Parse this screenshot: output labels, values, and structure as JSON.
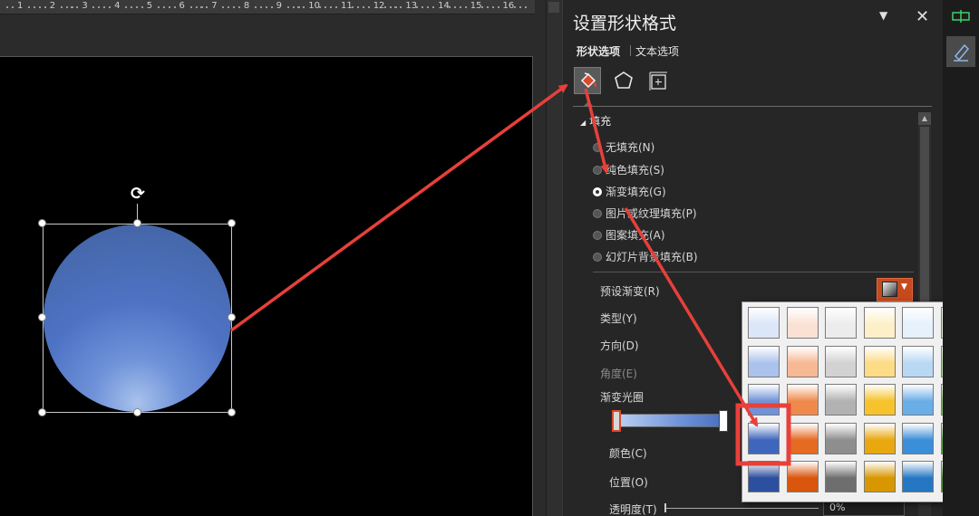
{
  "ruler": {
    "labels": [
      "1",
      "2",
      "3",
      "4",
      "5",
      "6",
      "7",
      "8",
      "9",
      "10",
      "11",
      "12",
      "13",
      "14",
      "15",
      "16"
    ]
  },
  "pane": {
    "title": "设置形状格式",
    "tabs": [
      "形状选项",
      "文本选项"
    ],
    "menu_icon": "chevron-down-icon",
    "close_icon": "close-icon",
    "category_icons": [
      "paint-bucket-icon",
      "pentagon-icon",
      "size-properties-icon"
    ]
  },
  "fill": {
    "section_label": "填充",
    "options": [
      {
        "label": "无填充(N)",
        "checked": false
      },
      {
        "label": "纯色填充(S)",
        "checked": false
      },
      {
        "label": "渐变填充(G)",
        "checked": true
      },
      {
        "label": "图片或纹理填充(P)",
        "checked": false
      },
      {
        "label": "图案填充(A)",
        "checked": false
      },
      {
        "label": "幻灯片背景填充(B)",
        "checked": false
      }
    ]
  },
  "gradient": {
    "preset_label": "预设渐变(R)",
    "type_label": "类型(Y)",
    "direction_label": "方向(D)",
    "angle_label": "角度(E)",
    "stops_label": "渐变光圈",
    "color_label": "颜色(C)",
    "position_label": "位置(O)",
    "transparency_label": "透明度(T)",
    "transparency_value": "0%"
  },
  "preset_gallery": {
    "rows": 5,
    "columns": [
      "blue",
      "orange",
      "gray",
      "gold",
      "lightblue",
      "green"
    ],
    "selected": {
      "row": 4,
      "column": 1
    },
    "colors": {
      "blue": [
        "#dbe6f8",
        "#aac2ec",
        "#6f93d9",
        "#3f66bd",
        "#2c4f9f"
      ],
      "orange": [
        "#fbe1d4",
        "#f7b894",
        "#ef8a4c",
        "#e56a22",
        "#d9560c"
      ],
      "gray": [
        "#ececec",
        "#d2d2d2",
        "#b2b2b2",
        "#8e8e8e",
        "#6e6e6e"
      ],
      "gold": [
        "#fdf0c8",
        "#fcdc84",
        "#f6c32c",
        "#e9a80f",
        "#d89700"
      ],
      "lightblue": [
        "#e6f1fb",
        "#b9d8f4",
        "#6aaee8",
        "#3b8ed8",
        "#2577c4"
      ],
      "green": [
        "#e3f2dc",
        "#bfe0ad",
        "#86c064",
        "#5ea33b",
        "#4a8a2b"
      ]
    }
  },
  "colors": {
    "accent": "#c64a1e",
    "annotation": "#e8403a"
  },
  "right_strip": {
    "icons": [
      "selection-pane-icon",
      "format-shape-icon"
    ]
  }
}
